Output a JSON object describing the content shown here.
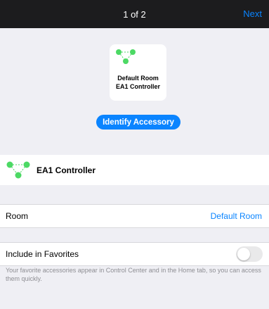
{
  "header": {
    "title": "1 of 2",
    "next_label": "Next"
  },
  "accessory_card": {
    "line1": "Default Room",
    "line2": "EA1 Controller",
    "icon": "network-nodes-icon"
  },
  "identify_button": "Identify Accessory",
  "accessory_row": {
    "name": "EA1 Controller",
    "icon": "network-nodes-icon"
  },
  "room_row": {
    "label": "Room",
    "value": "Default Room"
  },
  "favorites_row": {
    "label": "Include in Favorites",
    "enabled": false
  },
  "favorites_footer": "Your favorite accessories appear in Control Center and in the Home tab, so you can access them quickly.",
  "colors": {
    "accent": "#0a84ff",
    "node_green": "#4cd964",
    "header_bg": "#1c1c1e"
  }
}
